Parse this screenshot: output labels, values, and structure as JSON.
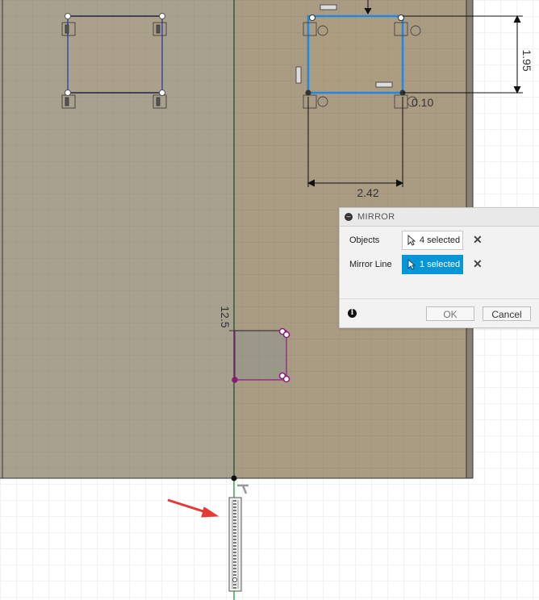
{
  "sketch": {
    "dimensions": {
      "height_value": "1.95",
      "width_value": "2.42",
      "offset_value": "0.10",
      "vertical_value": "12.5"
    }
  },
  "mirror_dialog": {
    "title": "MIRROR",
    "objects_label": "Objects",
    "objects_value": "4 selected",
    "mirror_line_label": "Mirror Line",
    "mirror_line_value": "1 selected",
    "ok_label": "OK",
    "cancel_label": "Cancel"
  },
  "colors": {
    "body_left": "#a8a18f",
    "body_right": "#aa9c83",
    "sketch_blue": "#1e88e5",
    "profile_purple": "#8b1a7b",
    "axis_green": "#3aa84a",
    "annotation_red": "#e53935",
    "accent": "#0696d7"
  }
}
